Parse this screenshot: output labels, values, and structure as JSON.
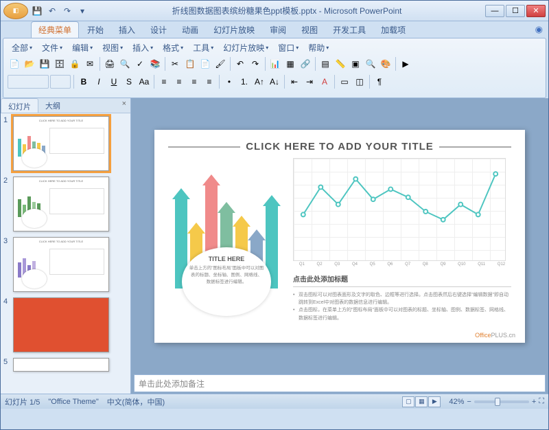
{
  "app": {
    "title": "折线图数据图表缤纷糖果色ppt模板.pptx - Microsoft PowerPoint"
  },
  "ribbon": {
    "tabs": [
      "经典菜单",
      "开始",
      "插入",
      "设计",
      "动画",
      "幻灯片放映",
      "审阅",
      "视图",
      "开发工具",
      "加载项"
    ],
    "active_tab": "经典菜单",
    "menus": [
      "全部",
      "文件",
      "编辑",
      "视图",
      "插入",
      "格式",
      "工具",
      "幻灯片放映",
      "窗口",
      "帮助"
    ]
  },
  "thumbnails": {
    "tabs": [
      "幻灯片",
      "大纲"
    ],
    "active_tab": "幻灯片",
    "count": 5,
    "selected": 1
  },
  "slide": {
    "main_title": "CLICK HERE TO ADD YOUR TITLE",
    "circle_title": "TITLE HERE",
    "circle_text": "单击上方的\"图标布局\"面板中可以对图表的标题、坐标轴、图例、网格线、数据标签进行编辑。",
    "sub_heading": "点击此处添加标题",
    "bullet1": "双击图标可以对图表面形及文字的取色、边框等进行选择。点击图表然后右键选择\"编辑数据\"即自动跳转到Excel中对图表的数据信息进行编辑。",
    "bullet2": "点击图标，在菜单上方的\"图标布局\"面板中可以对图表的标题、坐标轴、图例、数据标签、网格线、数据标签进行编辑。",
    "watermark_prefix": "Office",
    "watermark_suffix": "PLUS.cn"
  },
  "chart_data": {
    "type": "line",
    "categories": [
      "Q1",
      "Q2",
      "Q3",
      "Q4",
      "Q5",
      "Q6",
      "Q7",
      "Q8",
      "Q9",
      "Q10",
      "Q11",
      "Q12"
    ],
    "values": [
      45,
      72,
      55,
      80,
      60,
      70,
      62,
      48,
      40,
      55,
      45,
      85
    ],
    "ylim": [
      0,
      100
    ],
    "title": "",
    "xlabel": "",
    "ylabel": "",
    "color": "#4dc5c0"
  },
  "arrows": [
    {
      "color": "#4dc5c0",
      "height": 130,
      "x": 10
    },
    {
      "color": "#f5c94a",
      "height": 80,
      "x": 32
    },
    {
      "color": "#f08a8a",
      "height": 150,
      "x": 54
    },
    {
      "color": "#7fbea0",
      "height": 110,
      "x": 76
    },
    {
      "color": "#f5c94a",
      "height": 90,
      "x": 98
    },
    {
      "color": "#8aa8c8",
      "height": 70,
      "x": 120
    },
    {
      "color": "#4dc5c0",
      "height": 120,
      "x": 142
    }
  ],
  "notes": {
    "placeholder": "单击此处添加备注"
  },
  "status": {
    "slide_indicator": "幻灯片 1/5",
    "theme": "\"Office Theme\"",
    "language": "中文(简体，中国)",
    "zoom": "42%"
  }
}
